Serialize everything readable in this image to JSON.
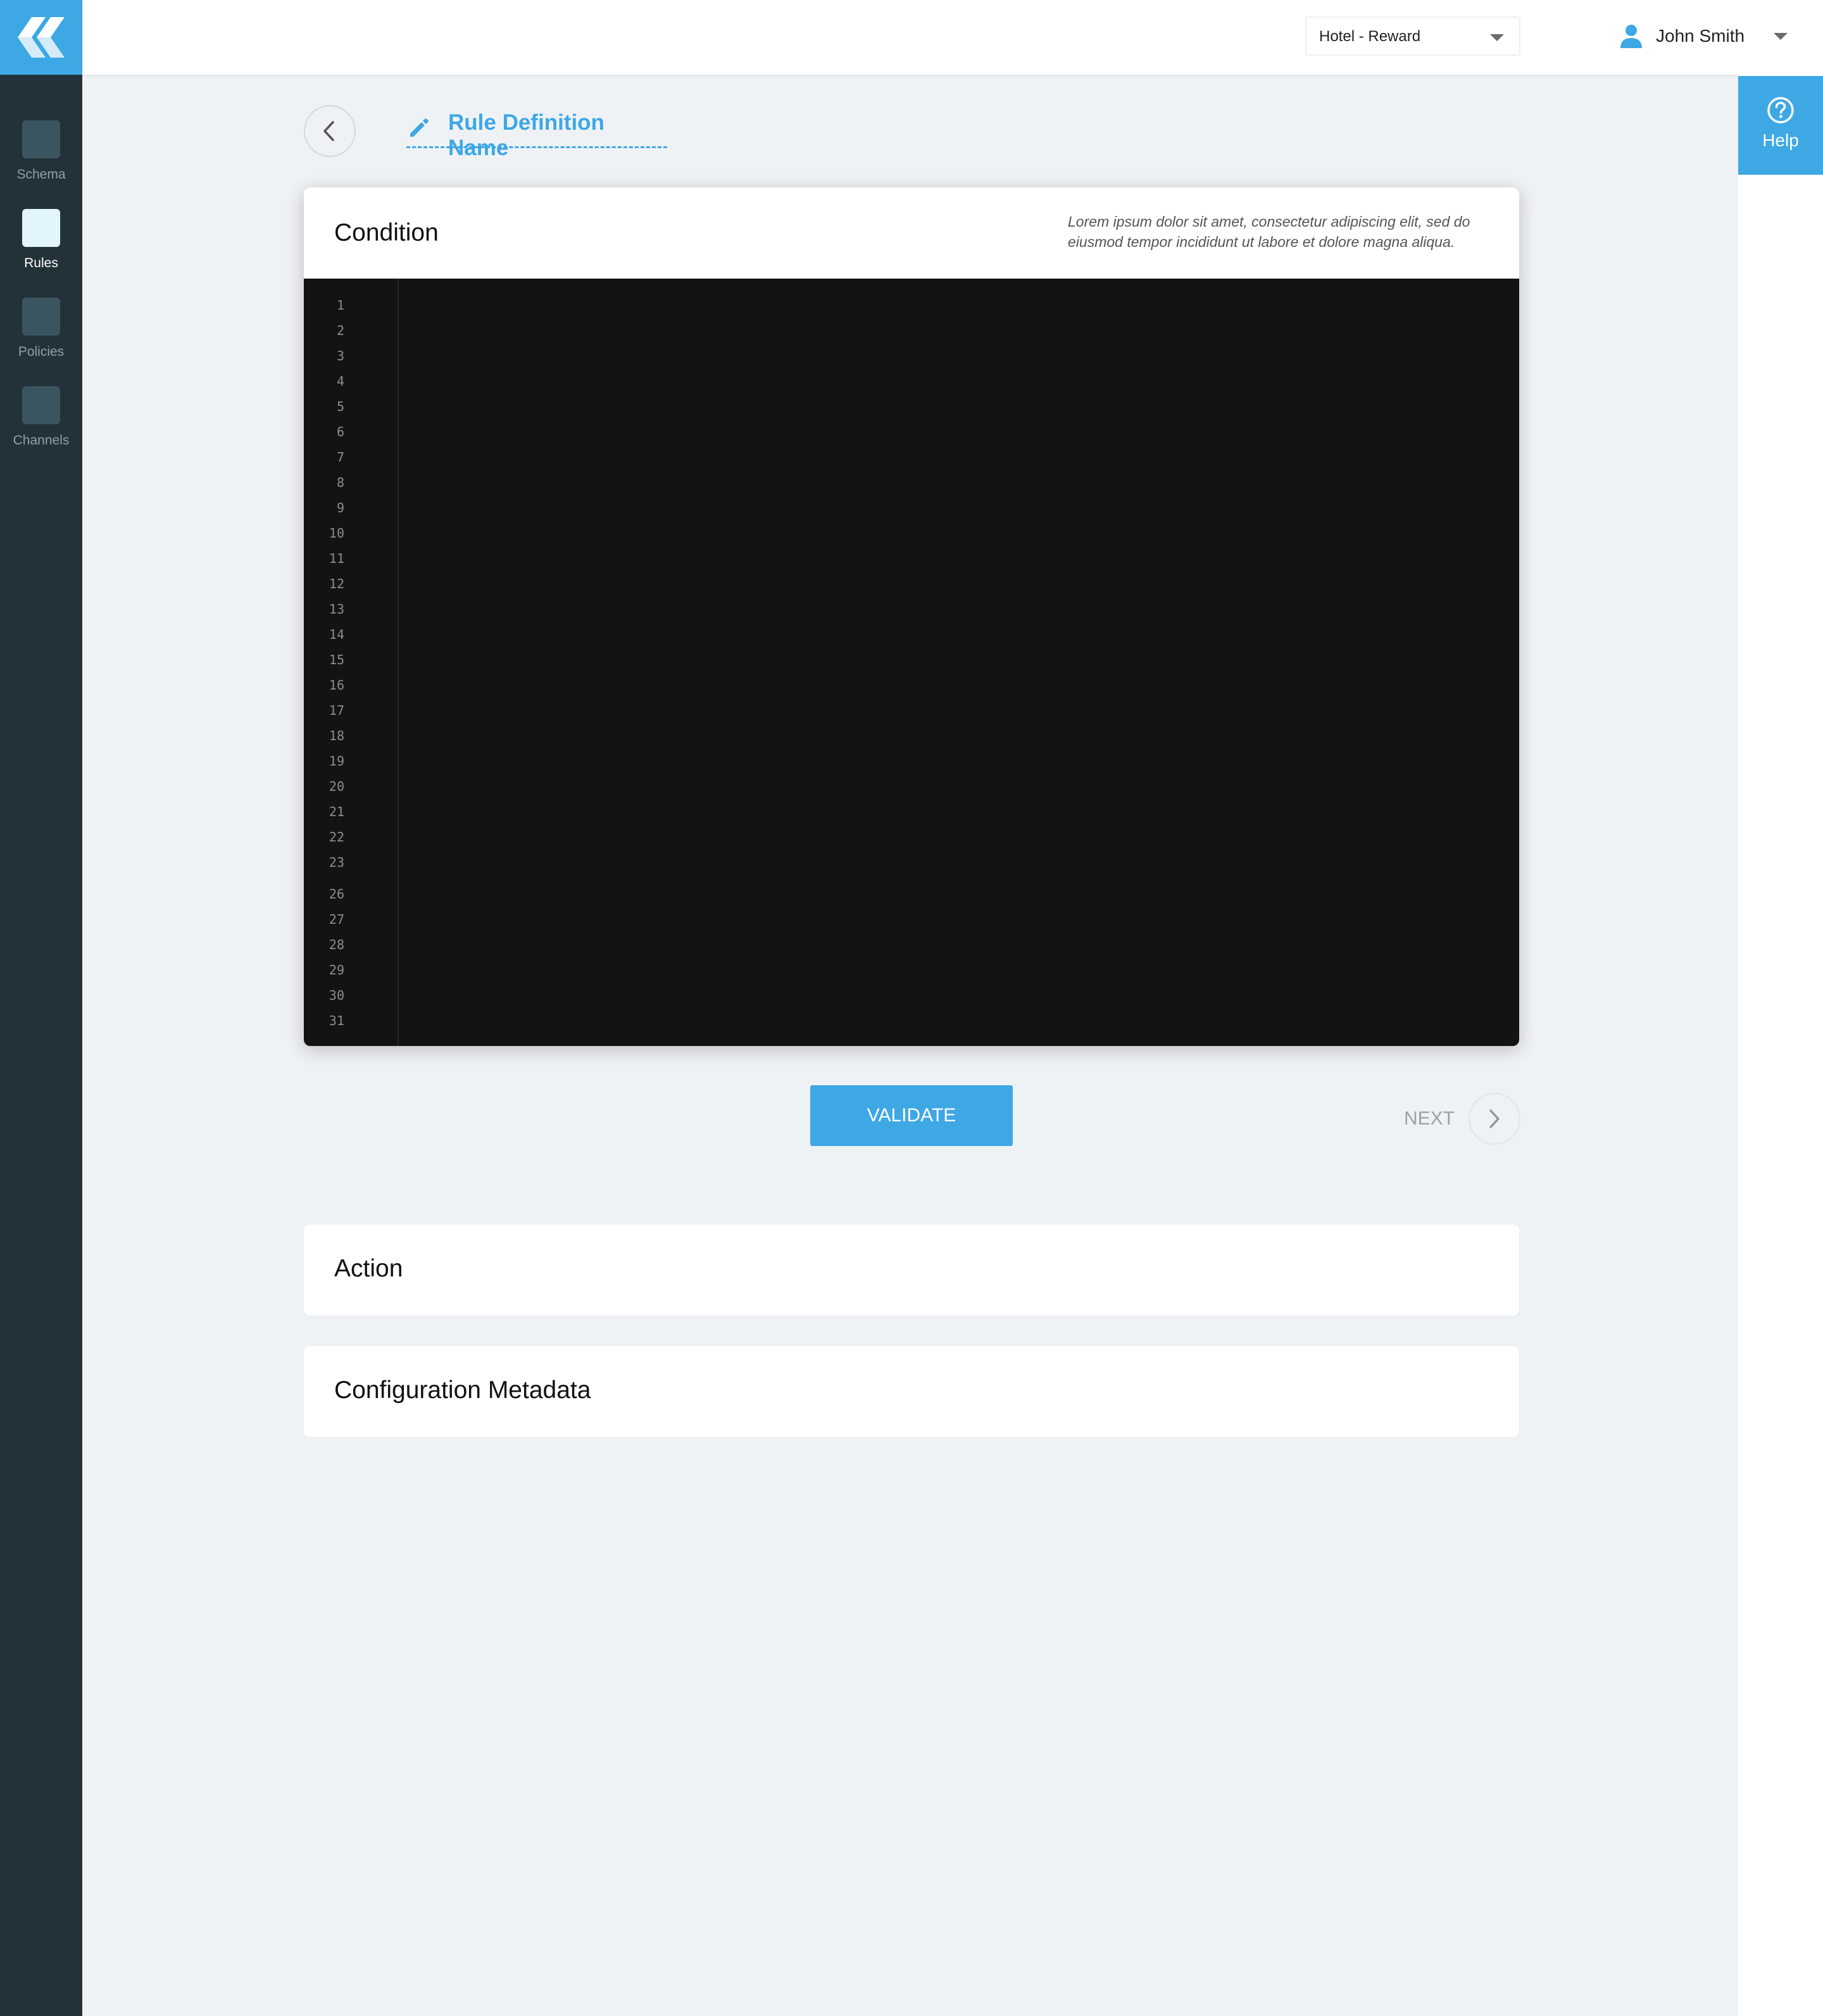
{
  "brand": {
    "logo_icon": "k-logo-icon",
    "accent": "#3ea8e5"
  },
  "sidebar": {
    "items": [
      {
        "label": "Schema",
        "active": false
      },
      {
        "label": "Rules",
        "active": true
      },
      {
        "label": "Policies",
        "active": false
      },
      {
        "label": "Channels",
        "active": false
      }
    ]
  },
  "topbar": {
    "hotel_select": "Hotel - Reward",
    "user_name": "John Smith"
  },
  "help": {
    "label": "Help"
  },
  "header": {
    "rule_name": "Rule Definition Name"
  },
  "condition": {
    "title": "Condition",
    "description": "Lorem ipsum dolor sit amet, consectetur adipiscing elit, sed do eiusmod tempor incididunt ut labore et dolore magna aliqua.",
    "line_numbers": [
      "1",
      "2",
      "3",
      "4",
      "5",
      "6",
      "7",
      "8",
      "9",
      "10",
      "11",
      "12",
      "13",
      "14",
      "15",
      "16",
      "17",
      "18",
      "19",
      "20",
      "21",
      "22",
      "23",
      "26",
      "27",
      "28",
      "29",
      "30",
      "31"
    ]
  },
  "buttons": {
    "validate": "VALIDATE",
    "next": "NEXT"
  },
  "sections": {
    "action": "Action",
    "metadata": "Configuration Metadata"
  }
}
